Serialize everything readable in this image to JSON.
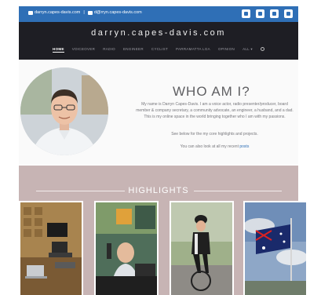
{
  "topbar": {
    "website": "darryn.capes-davis.com",
    "separator": "|",
    "email": "d@rryn.capes-davis.com",
    "social_icons": [
      "twitter-icon",
      "linkedin-icon",
      "instagram-icon",
      "email-icon"
    ]
  },
  "header": {
    "site_title": "darryn.capes-davis.com",
    "nav": [
      "HOME",
      "VOICEOVER",
      "RADIO",
      "ENGINEER",
      "CYCLIST",
      "PARRAMATTA LGA",
      "OPINION",
      "ALL ▾"
    ]
  },
  "about": {
    "heading": "WHO AM I?",
    "paragraph": "My name is Darryn Capes-Davis. I am a voice actor, radio presenter/producer, board member & company secretary, a community advocate, an engineer, a husband, and a dad. This is my online space in the world bringing together who I am with my passions.",
    "see_below": "See below for the my core highlights and projects.",
    "recent_prefix": "You can also look at all my recent",
    "recent_link": "posts"
  },
  "highlights": {
    "title": "HIGHLIGHTS"
  },
  "colors": {
    "topbar": "#2f6fb6",
    "header": "#1e1e24",
    "highlights_bg": "#c7b4b4"
  }
}
